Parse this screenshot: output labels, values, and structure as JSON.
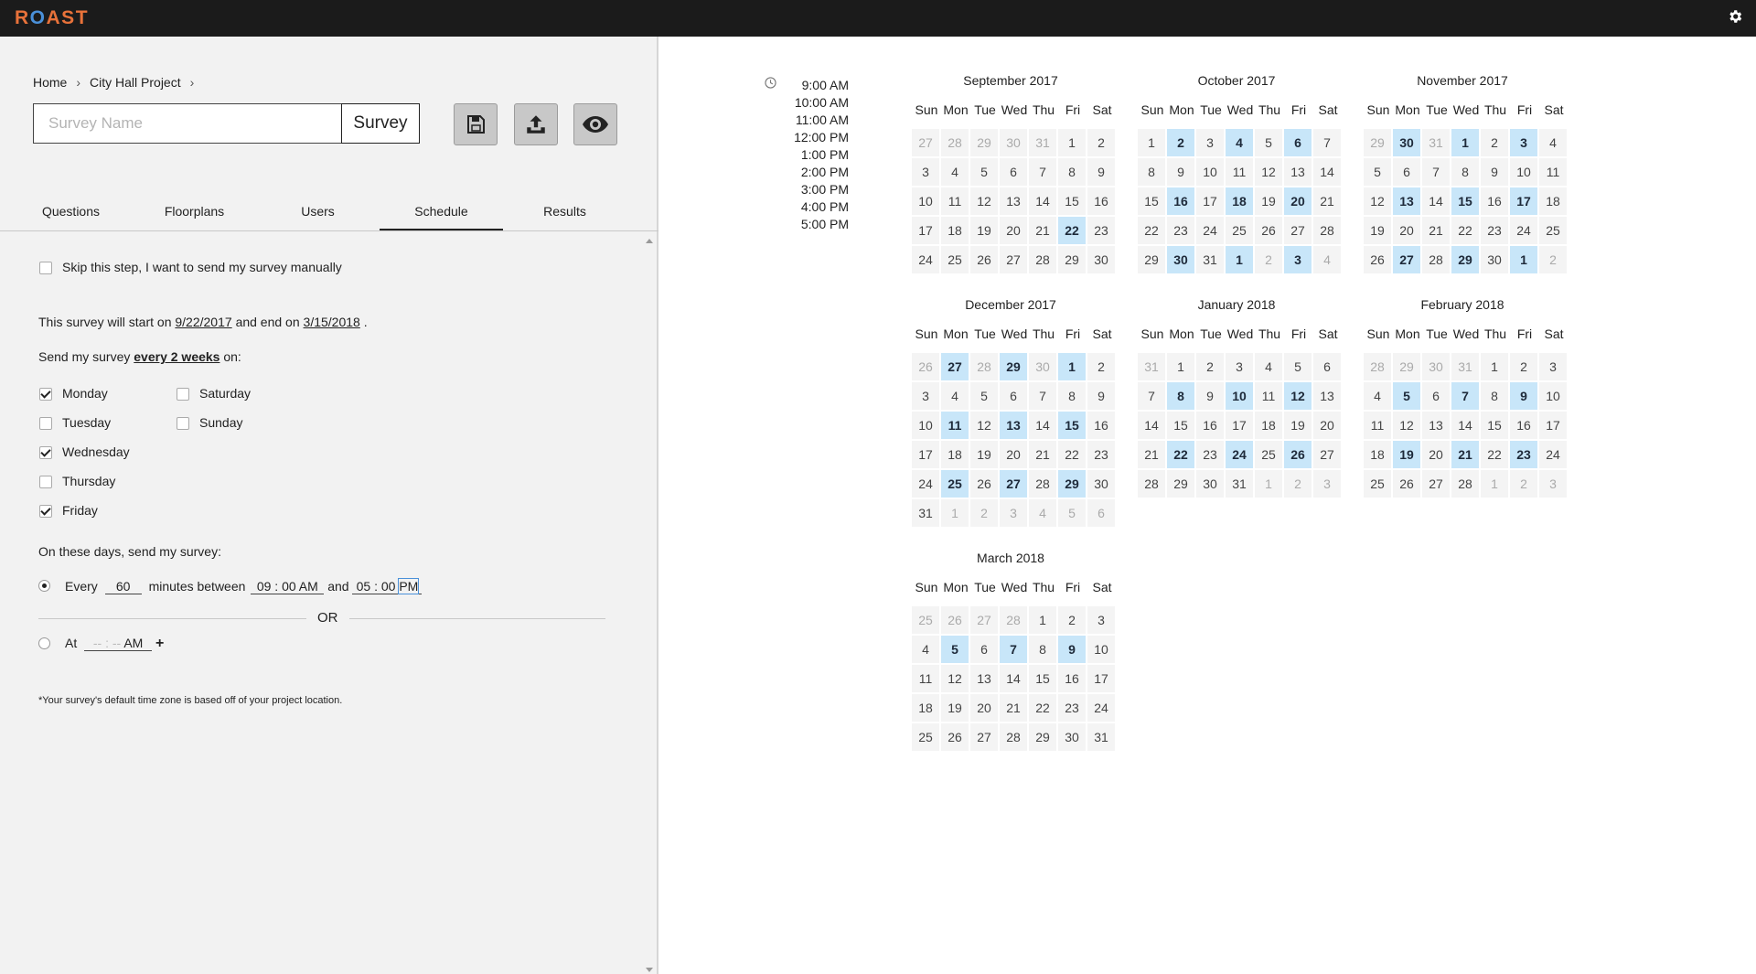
{
  "app": {
    "logo_prefix": "R",
    "logo_o": "O",
    "logo_suffix": "AST"
  },
  "header": {
    "settings_icon": "gear-icon"
  },
  "breadcrumb": {
    "home": "Home",
    "project": "City Hall Project",
    "separator": "›"
  },
  "survey": {
    "name_placeholder": "Survey Name",
    "name_value": "",
    "type_label": "Survey"
  },
  "toolbar": {
    "save_icon": "save-icon",
    "upload_icon": "upload-icon",
    "preview_icon": "eye-icon"
  },
  "tabs": [
    {
      "label": "Questions",
      "active": false
    },
    {
      "label": "Floorplans",
      "active": false
    },
    {
      "label": "Users",
      "active": false
    },
    {
      "label": "Schedule",
      "active": true
    },
    {
      "label": "Results",
      "active": false
    }
  ],
  "schedule": {
    "skip_label": "Skip this step, I want to send my survey manually",
    "skip_checked": false,
    "start_prefix": "This survey will start on",
    "start_date": "9/22/2017",
    "and_end_on": "and end on",
    "end_date": "3/15/2018",
    "period": ".",
    "send_prefix": "Send my survey",
    "frequency": "every 2 weeks",
    "send_suffix": "on:",
    "days": [
      {
        "label": "Monday",
        "checked": true
      },
      {
        "label": "Tuesday",
        "checked": false
      },
      {
        "label": "Wednesday",
        "checked": true
      },
      {
        "label": "Thursday",
        "checked": false
      },
      {
        "label": "Friday",
        "checked": true
      },
      {
        "label": "Saturday",
        "checked": false
      },
      {
        "label": "Sunday",
        "checked": false
      }
    ],
    "on_days_label": "On these days, send my survey:",
    "every_option": {
      "selected": true,
      "every_label": "Every",
      "minutes": "60",
      "minutes_between_label": "minutes between",
      "start_hour": "09",
      "start_min": "00",
      "start_ampm": "AM",
      "and_label": "and",
      "end_hour": "05",
      "end_min": "00",
      "end_ampm": "PM",
      "colon": ":"
    },
    "or_label": "OR",
    "at_option": {
      "selected": false,
      "at_label": "At",
      "hour": "--",
      "min": "--",
      "ampm": "AM",
      "colon": ":",
      "add_label": "+"
    },
    "footnote": "*Your survey's default time zone is based off of your project location."
  },
  "times": [
    "9:00 AM",
    "10:00 AM",
    "11:00 AM",
    "12:00 PM",
    "1:00 PM",
    "2:00 PM",
    "3:00 PM",
    "4:00 PM",
    "5:00 PM"
  ],
  "weekdays": [
    "Sun",
    "Mon",
    "Tue",
    "Wed",
    "Thu",
    "Fri",
    "Sat"
  ],
  "calendar": [
    {
      "title": "September 2017",
      "days": [
        [
          "27",
          "o"
        ],
        [
          "28",
          "o"
        ],
        [
          "29",
          "o"
        ],
        [
          "30",
          "o"
        ],
        [
          "31",
          "o"
        ],
        [
          "1"
        ],
        [
          "2"
        ],
        [
          "3"
        ],
        [
          "4"
        ],
        [
          "5"
        ],
        [
          "6"
        ],
        [
          "7"
        ],
        [
          "8"
        ],
        [
          "9"
        ],
        [
          "10"
        ],
        [
          "11"
        ],
        [
          "12"
        ],
        [
          "13"
        ],
        [
          "14"
        ],
        [
          "15"
        ],
        [
          "16"
        ],
        [
          "17"
        ],
        [
          "18"
        ],
        [
          "19"
        ],
        [
          "20"
        ],
        [
          "21"
        ],
        [
          "22",
          "s"
        ],
        [
          "23"
        ],
        [
          "24"
        ],
        [
          "25"
        ],
        [
          "26"
        ],
        [
          "27"
        ],
        [
          "28"
        ],
        [
          "29"
        ],
        [
          "30"
        ]
      ]
    },
    {
      "title": "October 2017",
      "days": [
        [
          "1"
        ],
        [
          "2",
          "s"
        ],
        [
          "3"
        ],
        [
          "4",
          "s"
        ],
        [
          "5"
        ],
        [
          "6",
          "s"
        ],
        [
          "7"
        ],
        [
          "8"
        ],
        [
          "9"
        ],
        [
          "10"
        ],
        [
          "11"
        ],
        [
          "12"
        ],
        [
          "13"
        ],
        [
          "14"
        ],
        [
          "15"
        ],
        [
          "16",
          "s"
        ],
        [
          "17"
        ],
        [
          "18",
          "s"
        ],
        [
          "19"
        ],
        [
          "20",
          "s"
        ],
        [
          "21"
        ],
        [
          "22"
        ],
        [
          "23"
        ],
        [
          "24"
        ],
        [
          "25"
        ],
        [
          "26"
        ],
        [
          "27"
        ],
        [
          "28"
        ],
        [
          "29"
        ],
        [
          "30",
          "s"
        ],
        [
          "31"
        ],
        [
          "1",
          "s"
        ],
        [
          "2",
          "o"
        ],
        [
          "3",
          "s"
        ],
        [
          "4",
          "o"
        ]
      ]
    },
    {
      "title": "November 2017",
      "days": [
        [
          "29",
          "o"
        ],
        [
          "30",
          "s"
        ],
        [
          "31",
          "o"
        ],
        [
          "1",
          "s"
        ],
        [
          "2"
        ],
        [
          "3",
          "s"
        ],
        [
          "4"
        ],
        [
          "5"
        ],
        [
          "6"
        ],
        [
          "7"
        ],
        [
          "8"
        ],
        [
          "9"
        ],
        [
          "10"
        ],
        [
          "11"
        ],
        [
          "12"
        ],
        [
          "13",
          "s"
        ],
        [
          "14"
        ],
        [
          "15",
          "s"
        ],
        [
          "16"
        ],
        [
          "17",
          "s"
        ],
        [
          "18"
        ],
        [
          "19"
        ],
        [
          "20"
        ],
        [
          "21"
        ],
        [
          "22"
        ],
        [
          "23"
        ],
        [
          "24"
        ],
        [
          "25"
        ],
        [
          "26"
        ],
        [
          "27",
          "s"
        ],
        [
          "28"
        ],
        [
          "29",
          "s"
        ],
        [
          "30"
        ],
        [
          "1",
          "s"
        ],
        [
          "2",
          "o"
        ]
      ]
    },
    {
      "title": "December 2017",
      "days": [
        [
          "26",
          "o"
        ],
        [
          "27",
          "s"
        ],
        [
          "28",
          "o"
        ],
        [
          "29",
          "s"
        ],
        [
          "30",
          "o"
        ],
        [
          "1",
          "s"
        ],
        [
          "2"
        ],
        [
          "3"
        ],
        [
          "4"
        ],
        [
          "5"
        ],
        [
          "6"
        ],
        [
          "7"
        ],
        [
          "8"
        ],
        [
          "9"
        ],
        [
          "10"
        ],
        [
          "11",
          "s"
        ],
        [
          "12"
        ],
        [
          "13",
          "s"
        ],
        [
          "14"
        ],
        [
          "15",
          "s"
        ],
        [
          "16"
        ],
        [
          "17"
        ],
        [
          "18"
        ],
        [
          "19"
        ],
        [
          "20"
        ],
        [
          "21"
        ],
        [
          "22"
        ],
        [
          "23"
        ],
        [
          "24"
        ],
        [
          "25",
          "s"
        ],
        [
          "26"
        ],
        [
          "27",
          "s"
        ],
        [
          "28"
        ],
        [
          "29",
          "s"
        ],
        [
          "30"
        ],
        [
          "31"
        ],
        [
          "1",
          "o"
        ],
        [
          "2",
          "o"
        ],
        [
          "3",
          "o"
        ],
        [
          "4",
          "o"
        ],
        [
          "5",
          "o"
        ],
        [
          "6",
          "o"
        ]
      ]
    },
    {
      "title": "January 2018",
      "days": [
        [
          "31",
          "o"
        ],
        [
          "1"
        ],
        [
          "2"
        ],
        [
          "3"
        ],
        [
          "4"
        ],
        [
          "5"
        ],
        [
          "6"
        ],
        [
          "7"
        ],
        [
          "8",
          "s"
        ],
        [
          "9"
        ],
        [
          "10",
          "s"
        ],
        [
          "11"
        ],
        [
          "12",
          "s"
        ],
        [
          "13"
        ],
        [
          "14"
        ],
        [
          "15"
        ],
        [
          "16"
        ],
        [
          "17"
        ],
        [
          "18"
        ],
        [
          "19"
        ],
        [
          "20"
        ],
        [
          "21"
        ],
        [
          "22",
          "s"
        ],
        [
          "23"
        ],
        [
          "24",
          "s"
        ],
        [
          "25"
        ],
        [
          "26",
          "s"
        ],
        [
          "27"
        ],
        [
          "28"
        ],
        [
          "29"
        ],
        [
          "30"
        ],
        [
          "31"
        ],
        [
          "1",
          "o"
        ],
        [
          "2",
          "o"
        ],
        [
          "3",
          "o"
        ]
      ]
    },
    {
      "title": "February 2018",
      "days": [
        [
          "28",
          "o"
        ],
        [
          "29",
          "o"
        ],
        [
          "30",
          "o"
        ],
        [
          "31",
          "o"
        ],
        [
          "1"
        ],
        [
          "2"
        ],
        [
          "3"
        ],
        [
          "4"
        ],
        [
          "5",
          "s"
        ],
        [
          "6"
        ],
        [
          "7",
          "s"
        ],
        [
          "8"
        ],
        [
          "9",
          "s"
        ],
        [
          "10"
        ],
        [
          "11"
        ],
        [
          "12"
        ],
        [
          "13"
        ],
        [
          "14"
        ],
        [
          "15"
        ],
        [
          "16"
        ],
        [
          "17"
        ],
        [
          "18"
        ],
        [
          "19",
          "s"
        ],
        [
          "20"
        ],
        [
          "21",
          "s"
        ],
        [
          "22"
        ],
        [
          "23",
          "s"
        ],
        [
          "24"
        ],
        [
          "25"
        ],
        [
          "26"
        ],
        [
          "27"
        ],
        [
          "28"
        ],
        [
          "1",
          "o"
        ],
        [
          "2",
          "o"
        ],
        [
          "3",
          "o"
        ]
      ]
    },
    {
      "title": "March 2018",
      "days": [
        [
          "25",
          "o"
        ],
        [
          "26",
          "o"
        ],
        [
          "27",
          "o"
        ],
        [
          "28",
          "o"
        ],
        [
          "1"
        ],
        [
          "2"
        ],
        [
          "3"
        ],
        [
          "4"
        ],
        [
          "5",
          "s"
        ],
        [
          "6"
        ],
        [
          "7",
          "s"
        ],
        [
          "8"
        ],
        [
          "9",
          "s"
        ],
        [
          "10"
        ],
        [
          "11"
        ],
        [
          "12"
        ],
        [
          "13"
        ],
        [
          "14"
        ],
        [
          "15"
        ],
        [
          "16"
        ],
        [
          "17"
        ],
        [
          "18"
        ],
        [
          "19"
        ],
        [
          "20"
        ],
        [
          "21"
        ],
        [
          "22"
        ],
        [
          "23"
        ],
        [
          "24"
        ],
        [
          "25"
        ],
        [
          "26"
        ],
        [
          "27"
        ],
        [
          "28"
        ],
        [
          "29"
        ],
        [
          "30"
        ],
        [
          "31"
        ]
      ]
    }
  ],
  "colors": {
    "topbar": "#1b1b1b",
    "logo_orange": "#e8723a",
    "logo_blue": "#4a90d9",
    "selected_day": "#c8e6f9",
    "panel_bg": "#f2f2f2"
  }
}
